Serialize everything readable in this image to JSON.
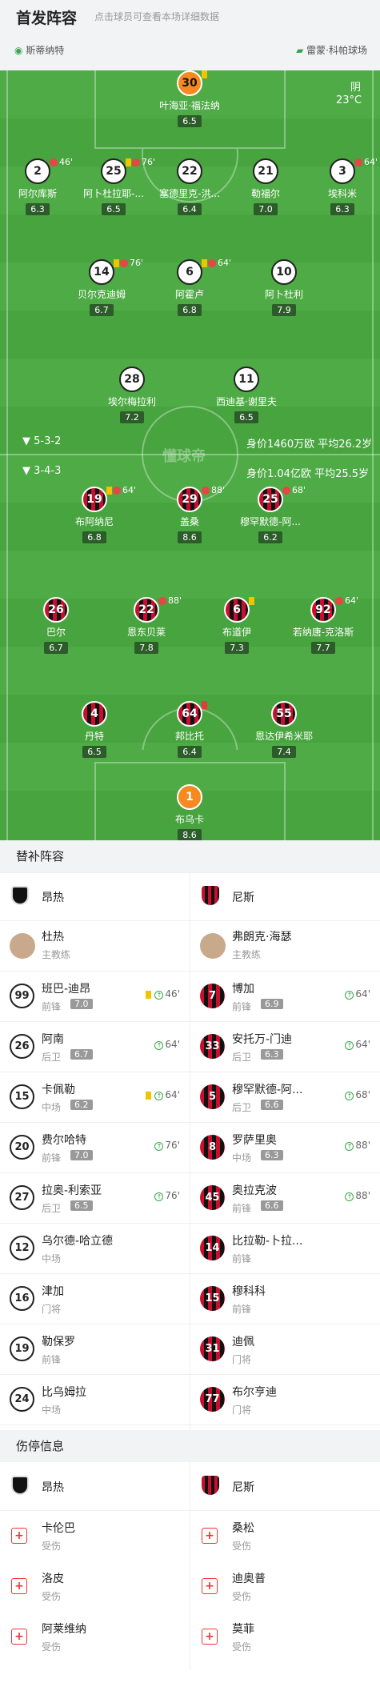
{
  "header": {
    "title": "首发阵容",
    "subtitle": "点击球员可查看本场详细数据",
    "venue_label": "斯蒂纳特",
    "stadium": "雷蒙·科帕球场"
  },
  "weather": {
    "condition": "阴",
    "temp": "23°C"
  },
  "watermark": "懂球帝",
  "angers_info": {
    "formation": "5-3-2",
    "value": "身价1460万欧",
    "avg_age": "平均26.2岁"
  },
  "nice_info": {
    "formation": "3-4-3",
    "value": "身价1.04亿欧",
    "avg_age": "平均25.5岁"
  },
  "starters": [
    {
      "num": "30",
      "name": "叶海亚·福法纳",
      "rating": "6.5",
      "style": "gk1",
      "ev": "",
      "yc": true
    },
    {
      "num": "2",
      "name": "阿尔库斯",
      "rating": "6.3",
      "style": "w",
      "ev": "46'"
    },
    {
      "num": "25",
      "name": "阿卜杜拉耶-...",
      "rating": "6.5",
      "style": "w",
      "ev": "76'",
      "yc": true
    },
    {
      "num": "22",
      "name": "塞德里克-洪...",
      "rating": "6.4",
      "style": "w",
      "ev": ""
    },
    {
      "num": "21",
      "name": "勒福尔",
      "rating": "7.0",
      "style": "w",
      "ev": ""
    },
    {
      "num": "3",
      "name": "埃科米",
      "rating": "6.3",
      "style": "w",
      "ev": "64'"
    },
    {
      "num": "14",
      "name": "贝尔克迪姆",
      "rating": "6.7",
      "style": "w",
      "ev": "76'",
      "yc": true
    },
    {
      "num": "6",
      "name": "阿霍卢",
      "rating": "6.8",
      "style": "w",
      "ev": "64'",
      "yc": true
    },
    {
      "num": "10",
      "name": "阿卜杜利",
      "rating": "7.9",
      "style": "w",
      "ev": ""
    },
    {
      "num": "28",
      "name": "埃尔梅拉利",
      "rating": "7.2",
      "style": "w",
      "ev": ""
    },
    {
      "num": "11",
      "name": "西迪基·谢里夫",
      "rating": "6.5",
      "style": "w",
      "ev": ""
    },
    {
      "num": "19",
      "name": "布阿纳尼",
      "rating": "6.8",
      "style": "rb",
      "ev": "64'",
      "yc": true
    },
    {
      "num": "29",
      "name": "盖桑",
      "rating": "8.6",
      "style": "rb",
      "ev": "88'"
    },
    {
      "num": "25",
      "name": "穆罕默德-阿...",
      "rating": "6.2",
      "style": "rb",
      "ev": "68'"
    },
    {
      "num": "26",
      "name": "巴尔",
      "rating": "6.7",
      "style": "rb",
      "ev": ""
    },
    {
      "num": "22",
      "name": "恩东贝莱",
      "rating": "7.8",
      "style": "rb",
      "ev": "88'"
    },
    {
      "num": "6",
      "name": "布道伊",
      "rating": "7.3",
      "style": "rb",
      "ev": "",
      "yc": true
    },
    {
      "num": "92",
      "name": "若纳唐-克洛斯",
      "rating": "7.7",
      "style": "rb",
      "ev": "64'"
    },
    {
      "num": "4",
      "name": "丹特",
      "rating": "6.5",
      "style": "rb",
      "ev": ""
    },
    {
      "num": "64",
      "name": "邦比托",
      "rating": "6.4",
      "style": "rb",
      "ev": "",
      "rc": true
    },
    {
      "num": "55",
      "name": "恩达伊希米耶",
      "rating": "7.4",
      "style": "rb",
      "ev": ""
    },
    {
      "num": "1",
      "name": "布乌卡",
      "rating": "8.6",
      "style": "gk2",
      "ev": ""
    }
  ],
  "subs_title": "替补阵容",
  "teams": {
    "left": "昂热",
    "right": "尼斯"
  },
  "coaches": {
    "left_name": "杜热",
    "right_name": "弗朗克·海瑟",
    "role": "主教练"
  },
  "subs_left": [
    {
      "num": "99",
      "name": "班巴-迪昂",
      "pos": "前锋",
      "rating": "7.0",
      "time": "46'",
      "yc": true
    },
    {
      "num": "26",
      "name": "阿南",
      "pos": "后卫",
      "rating": "6.7",
      "time": "64'"
    },
    {
      "num": "15",
      "name": "卡佩勒",
      "pos": "中场",
      "rating": "6.2",
      "time": "64'",
      "yc": true
    },
    {
      "num": "20",
      "name": "费尔哈特",
      "pos": "前锋",
      "rating": "7.0",
      "time": "76'"
    },
    {
      "num": "27",
      "name": "拉奥-利索亚",
      "pos": "后卫",
      "rating": "6.5",
      "time": "76'"
    },
    {
      "num": "12",
      "name": "乌尔德-哈立德",
      "pos": "中场",
      "rating": "",
      "time": ""
    },
    {
      "num": "16",
      "name": "津加",
      "pos": "门将",
      "rating": "",
      "time": ""
    },
    {
      "num": "19",
      "name": "勒保罗",
      "pos": "前锋",
      "rating": "",
      "time": ""
    },
    {
      "num": "24",
      "name": "比乌姆拉",
      "pos": "中场",
      "rating": "",
      "time": ""
    }
  ],
  "subs_right": [
    {
      "num": "7",
      "name": "博加",
      "pos": "前锋",
      "rating": "6.9",
      "time": "64'"
    },
    {
      "num": "33",
      "name": "安托万-门迪",
      "pos": "后卫",
      "rating": "6.3",
      "time": "64'"
    },
    {
      "num": "5",
      "name": "穆罕默德-阿...",
      "pos": "后卫",
      "rating": "6.6",
      "time": "68'"
    },
    {
      "num": "8",
      "name": "罗萨里奥",
      "pos": "中场",
      "rating": "6.3",
      "time": "88'"
    },
    {
      "num": "45",
      "name": "奥拉克波",
      "pos": "前锋",
      "rating": "6.6",
      "time": "88'"
    },
    {
      "num": "14",
      "name": "比拉勒-卜拉...",
      "pos": "前锋",
      "rating": "",
      "time": ""
    },
    {
      "num": "15",
      "name": "穆科科",
      "pos": "前锋",
      "rating": "",
      "time": ""
    },
    {
      "num": "31",
      "name": "迪佩",
      "pos": "门将",
      "rating": "",
      "time": ""
    },
    {
      "num": "77",
      "name": "布尔亨迪",
      "pos": "门将",
      "rating": "",
      "time": ""
    }
  ],
  "injury_title": "伤停信息",
  "injured_left": [
    {
      "name": "卡伦巴",
      "status": "受伤"
    },
    {
      "name": "洛皮",
      "status": "受伤"
    },
    {
      "name": "阿莱维纳",
      "status": "受伤"
    }
  ],
  "injured_right": [
    {
      "name": "桑松",
      "status": "受伤"
    },
    {
      "name": "迪奥普",
      "status": "受伤"
    },
    {
      "name": "莫菲",
      "status": "受伤"
    }
  ],
  "colors": {
    "pitch": "#48a43f",
    "nice_red": "#c8102e",
    "gk": "#f6891f"
  }
}
